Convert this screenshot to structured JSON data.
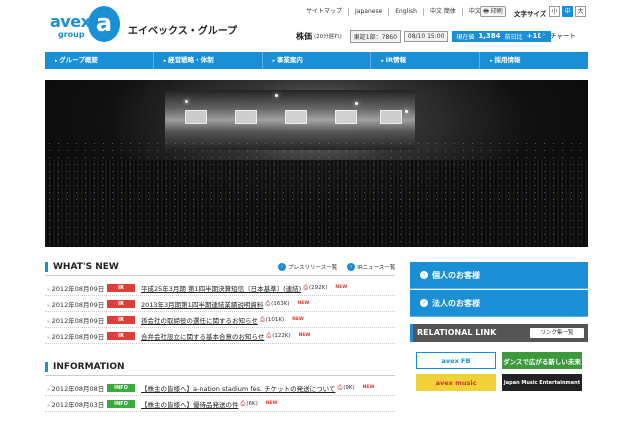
{
  "header": {
    "logo_text": "avex",
    "logo_sub": "group",
    "logo_mark": "a",
    "group_name": "エイベックス・グループ",
    "top_links": [
      "サイトマップ",
      "Japanese",
      "English",
      "中文 簡体",
      "中文 繁体"
    ],
    "print_label": "印刷",
    "fontsize_label": "文字サイズ",
    "fontsize_options": [
      "小",
      "中",
      "大"
    ],
    "stock": {
      "label": "株価",
      "delay": "(20分遅れ)",
      "code": "東証1部：7860",
      "time": "08/10 15:00",
      "price_label": "現在値",
      "price": "1,384",
      "change_label": "前日比",
      "change": "+184"
    },
    "chart_link": "チャート"
  },
  "nav": [
    "グループ概要",
    "経営戦略・体制",
    "事業案内",
    "IR情報",
    "採用情報"
  ],
  "whats_new": {
    "title": "WHAT'S NEW",
    "press_link": "プレスリリース一覧",
    "ir_link": "IRニュース一覧",
    "items": [
      {
        "date": "2012年08月09日",
        "badge": "IR",
        "text": "平成25年3月期 第1四半期決算短信〔日本基準〕(連結)",
        "size": "(292K)",
        "new": "NEW"
      },
      {
        "date": "2012年08月09日",
        "badge": "IR",
        "text": "2013年3月期第1四半期連結業績説明資料",
        "size": "(163K)",
        "new": "NEW"
      },
      {
        "date": "2012年08月09日",
        "badge": "IR",
        "text": "孫会社の取締役の選任に関するお知らせ",
        "size": "(101K)",
        "new": "NEW"
      },
      {
        "date": "2012年08月09日",
        "badge": "IR",
        "text": "合弁会社設立に関する基本合意のお知らせ",
        "size": "(122K)",
        "new": "NEW"
      }
    ]
  },
  "information": {
    "title": "INFORMATION",
    "items": [
      {
        "date": "2012年08月08日",
        "badge": "INFO",
        "text": "【株主の皆様へ】a-nation stadium fes. チケットの発送について",
        "size": "(9K)",
        "new": "NEW"
      },
      {
        "date": "2012年08月03日",
        "badge": "INFO",
        "text": "【株主の皆様へ】優待品発送の件",
        "size": "(6K)",
        "new": "NEW"
      }
    ]
  },
  "sidebar": {
    "individual": "個人のお客様",
    "corporate": "法人のお客様",
    "relational_title": "RELATIONAL LINK",
    "relational_link": "リンク集一覧",
    "banners": [
      "avex FB",
      "ダンスで広がる新しい未来",
      "avex music",
      "Japan Music Entertainment"
    ]
  },
  "colors": {
    "accent": "#1a8fd6",
    "ir": "#d9413b",
    "info": "#3caa3c"
  }
}
